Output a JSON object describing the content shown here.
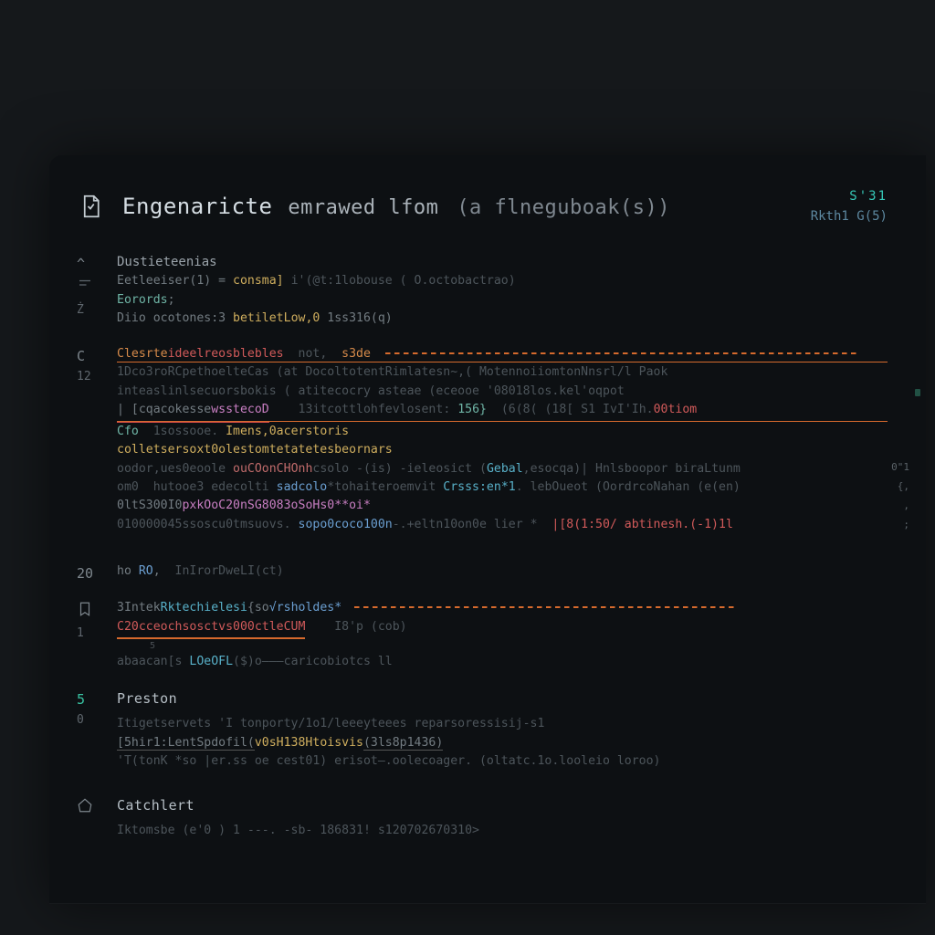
{
  "header": {
    "title_main": "Engenaricte",
    "title_mid": "emrawed lfom",
    "title_paren": "(a flneguboak(s))",
    "badge": "S'31",
    "subtitle": "Rkth1 G(5)"
  },
  "sections": {
    "s1": {
      "gutter": "^",
      "label": "Dustieteenias",
      "lines": [
        {
          "pre": "Eetleeiser(1) = ",
          "fn": "consma]",
          "rest": " i'(@t:1lobouse ( O.octobactrao)"
        },
        {
          "kw": "Eorords",
          "rest": ";"
        },
        {
          "pre": "Diio ocotones:3 ",
          "fn": "betiletLow,0",
          "rest": " 1ss316(q)"
        }
      ]
    },
    "s2": {
      "gutter1": "C",
      "gutter2": "12",
      "lines": [
        "Clesrteideelreosblebles  not,  s3de",
        "1Dco3roRCpethoelteCas  (at DocoltotentRimlatesn~,( MotennoiiomtonNnsrl/l Paok",
        "inteaslinlsecuorsbokis ( atitecocry  asteae (eceooe '08018los.kel'oqpot",
        "| [cqacokessewsstecoD   13itcottlohfevlosent: 156}  (6(8( (18[ S1 IvI'Ih.00tiom",
        "Cfo  1sossooe. Imens,0acerstoris",
        "colletsersoxt0olestomtetatetesbeornars",
        "oodor,ues0eoole ouCOonCHOnhcsolo -(is) -ieleosict (Gebal,esocqa)| Hnlsboopor biraLtunm",
        "om0  hutooe3 edecolti sadcolo*tohaiteroemvit Crsss:en*1. lebOueot (OordrcoNahan (e(en)",
        "0ltS300I0pxkOoC20nSG8083oSoHs0**oi*",
        "010000045ssoscu0tmsuovs. sopo0coco100n-.+eltn10on0e lier *  |[8(1:50/ abtinesh.(-1)1l"
      ]
    },
    "s3": {
      "gutter": "20",
      "lines": [
        "ho RO,  InIrorDweLI(ct)"
      ]
    },
    "s4": {
      "gutter_icon": "bookmark",
      "gutter2": "1",
      "lines": [
        "3IntekRktechielesi{so√rsholdes*",
        "C20cceochsosctvs000ctleCUM    I8'p (cob)",
        "5",
        "abaacan[s LOeOFL($)o———caricobiotcs ll"
      ]
    },
    "preston": {
      "gutter1": "5",
      "gutter2": "0",
      "title": "Preston",
      "lines": [
        "Itigetservets 'I tonporty/1o1/leeeyteees reparsoressisij-s1",
        "[5hir1:LentSpdofil(v0sH138Htoisvis(3ls8p1436)",
        "'T(tonK   *so |er.ss   oe  cest01)  erisot—.oolecoager.  (oltatc.1o.looleio loroo)"
      ]
    },
    "catchers": {
      "title": "Catchlert",
      "line": "Iktomsbe (e'0 ) 1  ---. -sb- 186831! s120702670310>"
    }
  },
  "right_nums": [
    "0\"1",
    "{,",
    ",",
    ";"
  ]
}
